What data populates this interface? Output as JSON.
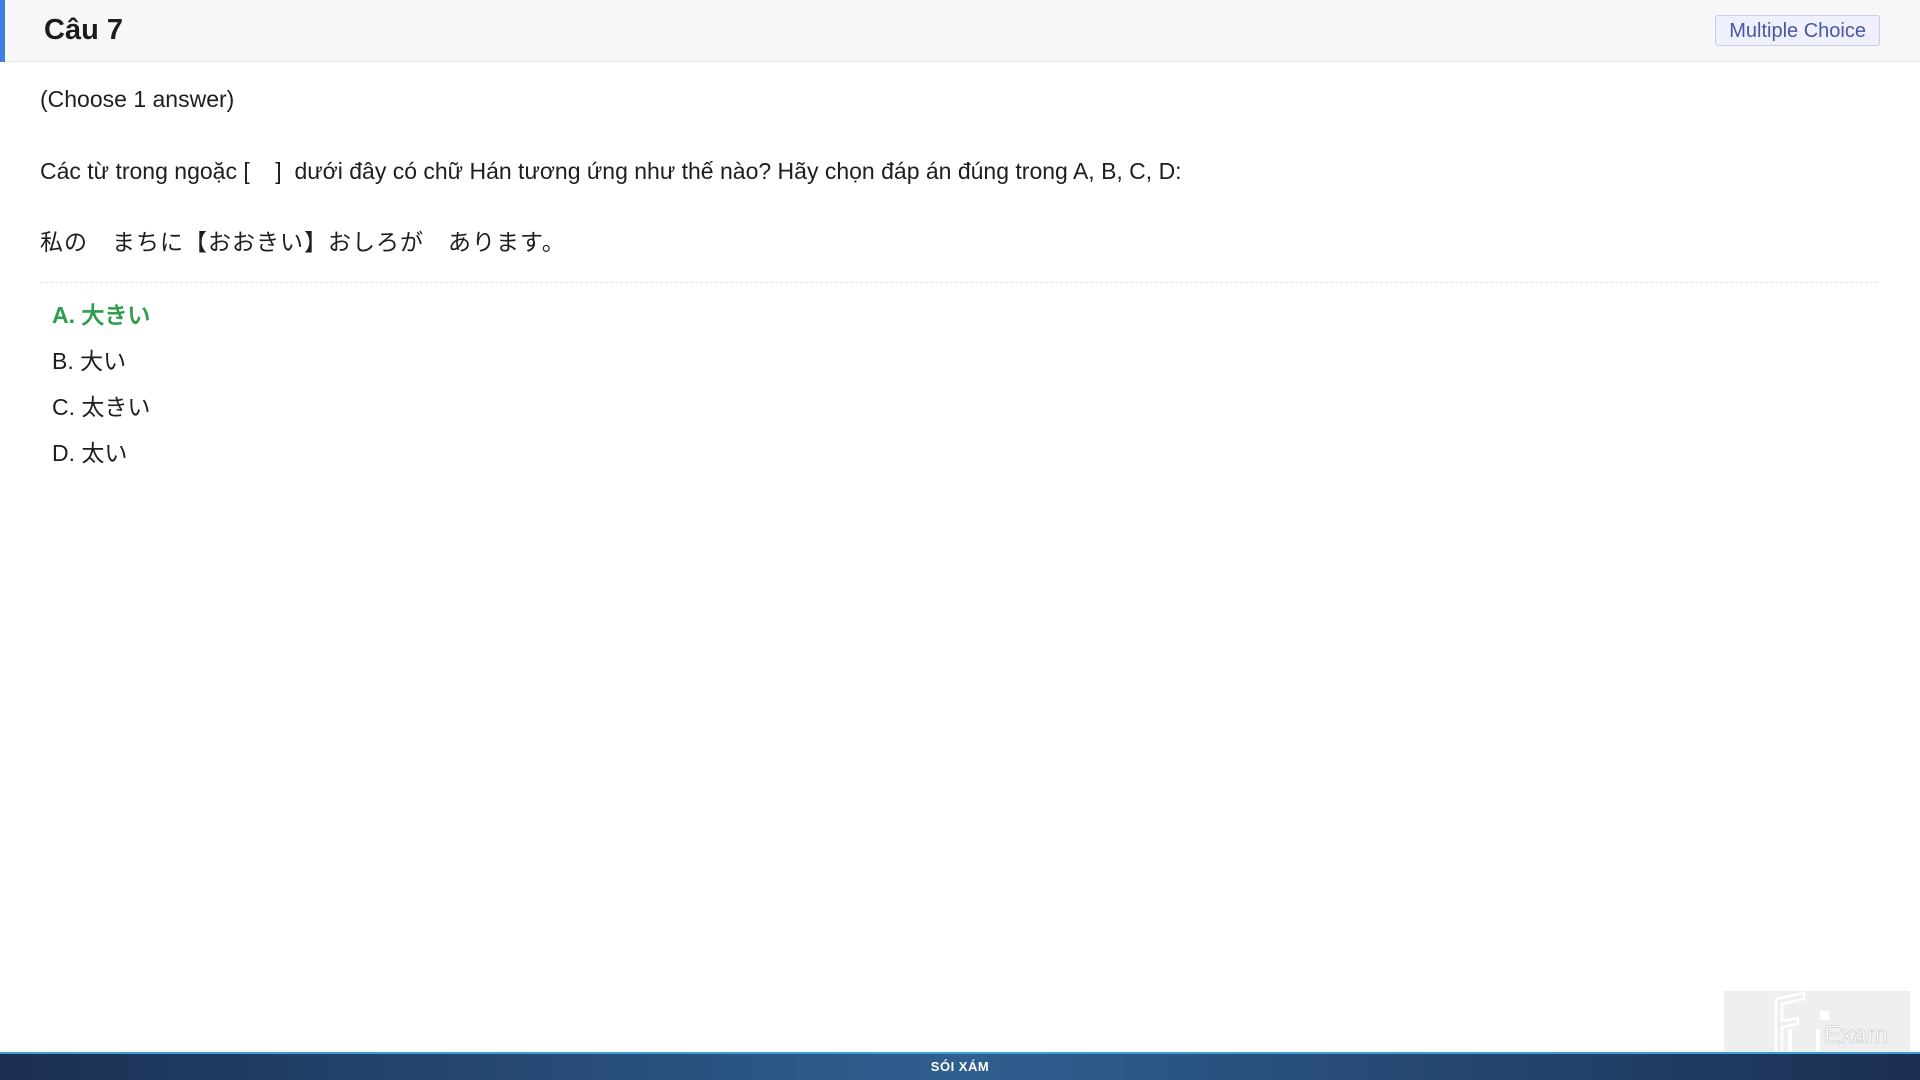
{
  "question": {
    "title": "Câu 7",
    "type_label": "Multiple Choice",
    "instruction": "(Choose 1 answer)",
    "prompt": "Các từ trong ngoặc [    ]  dưới đây có chữ Hán tương ứng như thế nào? Hãy chọn đáp án đúng trong A, B, C, D:",
    "sentence": "私の　まちに【おおきい】おしろが　あります。"
  },
  "options": [
    {
      "label": "A. 大きい",
      "correct": true
    },
    {
      "label": "B. 大い",
      "correct": false
    },
    {
      "label": "C. 太きい",
      "correct": false
    },
    {
      "label": "D. 太い",
      "correct": false
    }
  ],
  "footer": {
    "text": "SÓI XÁM"
  },
  "watermark": {
    "text": "FU Exam"
  },
  "colors": {
    "accent": "#3d7fe0",
    "correct": "#2e9e4c",
    "badge_text": "#4a56a6"
  }
}
